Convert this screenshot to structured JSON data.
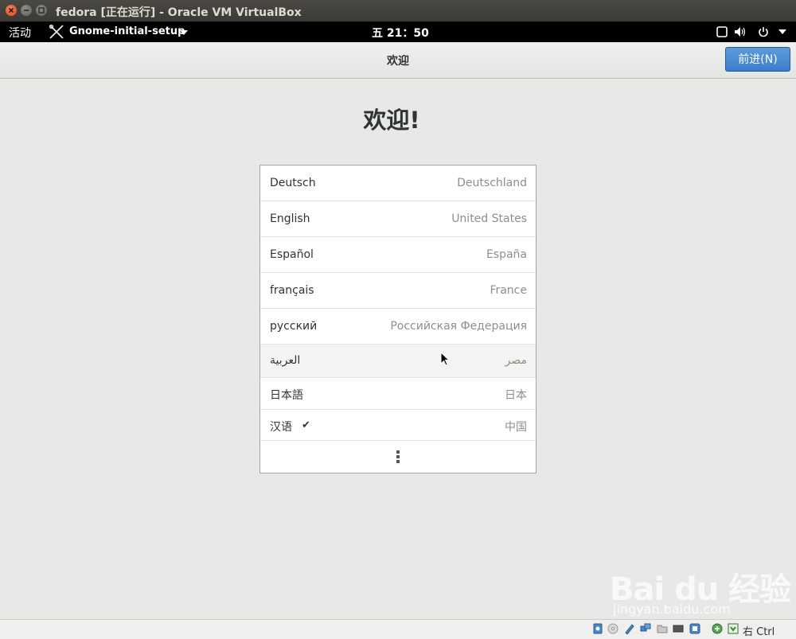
{
  "host_window": {
    "title": "fedora [正在运行] - Oracle VM VirtualBox"
  },
  "topbar": {
    "activities": "活动",
    "app_name": "Gnome-initial-setup",
    "clock": "五 21：50"
  },
  "header": {
    "title": "欢迎",
    "next_button": "前进(N)"
  },
  "main": {
    "heading": "欢迎!",
    "languages": [
      {
        "language": "Deutsch",
        "region": "Deutschland"
      },
      {
        "language": "English",
        "region": "United States"
      },
      {
        "language": "Español",
        "region": "España"
      },
      {
        "language": "français",
        "region": "France"
      },
      {
        "language": "русский",
        "region": "Российская Федерация"
      },
      {
        "language": "العربية",
        "region": "مصر"
      },
      {
        "language": "日本語",
        "region": "日本"
      },
      {
        "language": "汉语",
        "region": "中国",
        "selected": true
      }
    ],
    "selected_mark": "✔"
  },
  "statusbar": {
    "host_key": "右 Ctrl"
  },
  "watermark": {
    "brand": "Bai du 经验",
    "url": "jingyan.baidu.com"
  },
  "colors": {
    "accent": "#3b7dca",
    "background": "#e8e8e7"
  },
  "icons": [
    "close-icon",
    "minimize-icon",
    "maximize-icon",
    "tools-icon",
    "dropdown-arrow-icon",
    "display-icon",
    "volume-icon",
    "power-icon",
    "hard-disk-icon",
    "optical-disk-icon",
    "usb-icon",
    "network-icon",
    "shared-folder-icon",
    "display-status-icon",
    "video-capture-icon",
    "cpu-icon",
    "mouse-integration-icon",
    "keyboard-icon",
    "more-icon"
  ]
}
